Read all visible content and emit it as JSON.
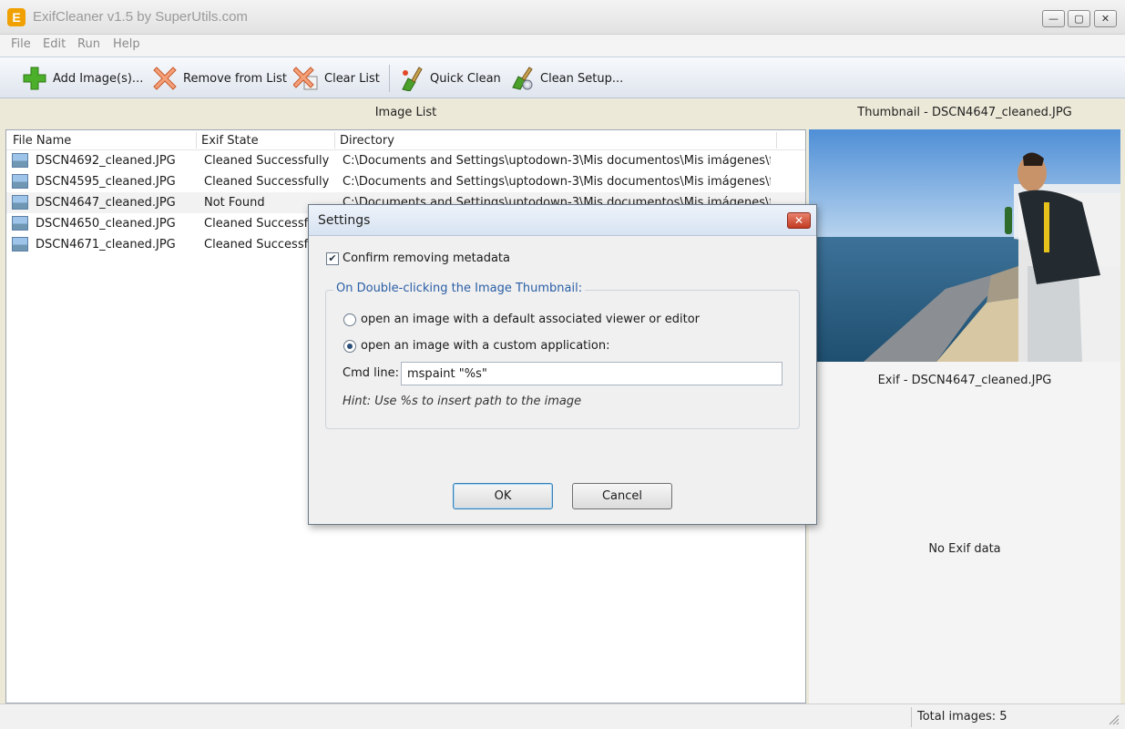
{
  "window": {
    "title": "ExifCleaner v1.5 by SuperUtils.com",
    "app_icon_letter": "E",
    "minimize": "—",
    "maximize": "▢",
    "close": "✕"
  },
  "menu": [
    "File",
    "Edit",
    "Run",
    "Help"
  ],
  "toolbar": {
    "add": "Add Image(s)...",
    "remove": "Remove from List",
    "clear": "Clear List",
    "quick_clean": "Quick Clean",
    "clean_setup": "Clean Setup..."
  },
  "image_list": {
    "heading": "Image List",
    "columns": [
      "File Name",
      "Exif State",
      "Directory"
    ],
    "rows": [
      {
        "file": "DSCN4692_cleaned.JPG",
        "state": "Cleaned Successfully",
        "dir": "C:\\Documents and Settings\\uptodown-3\\Mis documentos\\Mis imágenes\\fot..."
      },
      {
        "file": "DSCN4595_cleaned.JPG",
        "state": "Cleaned Successfully",
        "dir": "C:\\Documents and Settings\\uptodown-3\\Mis documentos\\Mis imágenes\\fot..."
      },
      {
        "file": "DSCN4647_cleaned.JPG",
        "state": "Not Found",
        "dir": "C:\\Documents and Settings\\uptodown-3\\Mis documentos\\Mis imágenes\\fot..."
      },
      {
        "file": "DSCN4650_cleaned.JPG",
        "state": "Cleaned Successfu",
        "dir": ""
      },
      {
        "file": "DSCN4671_cleaned.JPG",
        "state": "Cleaned Successfu",
        "dir": ""
      }
    ]
  },
  "thumbnail": {
    "heading": "Thumbnail - DSCN4647_cleaned.JPG"
  },
  "exif": {
    "heading": "Exif - DSCN4647_cleaned.JPG",
    "empty": "No Exif data"
  },
  "status": {
    "total": "Total images: 5"
  },
  "settings_dialog": {
    "title": "Settings",
    "close": "✕",
    "confirm_label": "Confirm removing metadata",
    "confirm_checked": true,
    "group_label": "On Double-clicking the Image Thumbnail:",
    "option_default": "open an image with a default associated viewer or editor",
    "option_custom": "open an image with a custom application:",
    "selected_option": "custom",
    "cmd_label": "Cmd line:",
    "cmd_value": "mspaint \"%s\"",
    "hint": "Hint: Use %s to insert path to the image",
    "ok": "OK",
    "cancel": "Cancel"
  },
  "colors": {
    "dialog_group_label": "#2a5ea6",
    "toolbar_bg": "#dfe5ee",
    "close_button": "#c23a22"
  }
}
